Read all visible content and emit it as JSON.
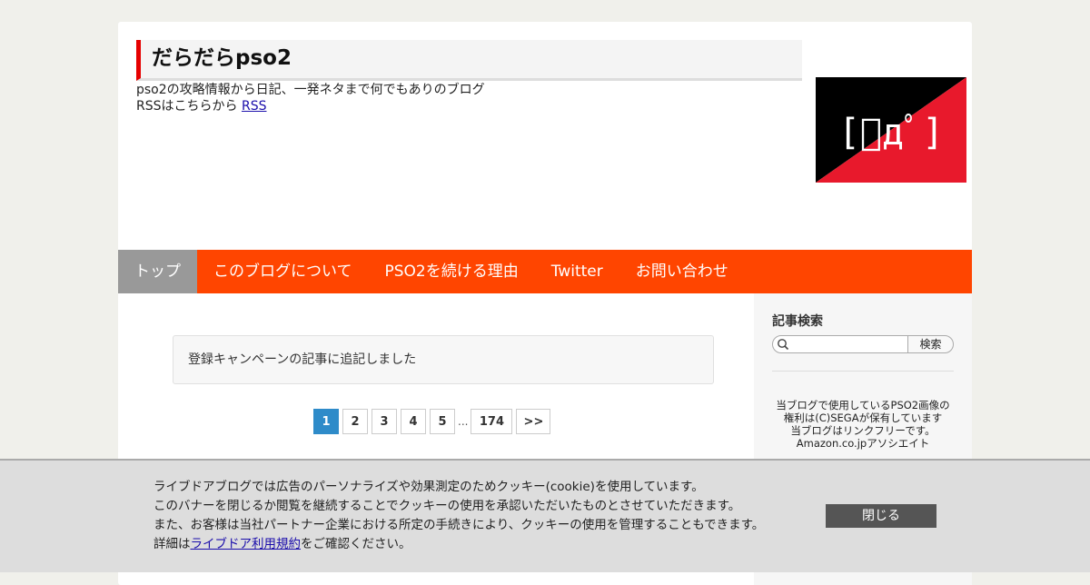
{
  "header": {
    "blog_title": "だらだらpso2",
    "tagline": "pso2の攻略情報から日記、一発ネタまで何でもありのブログ",
    "rss_prefix": "RSSはこちらから",
    "rss_link": "RSS",
    "logo_text": "[ﾟдﾟ]",
    "logo_colors": {
      "black": "#000000",
      "red": "#e8192c",
      "glyph": "#ffffff"
    }
  },
  "nav": {
    "items": [
      {
        "label": "トップ",
        "active": true
      },
      {
        "label": "このブログについて",
        "active": false
      },
      {
        "label": "PSO2を続ける理由",
        "active": false
      },
      {
        "label": "Twitter",
        "active": false
      },
      {
        "label": "お問い合わせ",
        "active": false
      }
    ],
    "bg_color": "#ff4500",
    "active_color": "#999999"
  },
  "main": {
    "notice": "登録キャンペーンの記事に追記しました",
    "pagination": {
      "pages": [
        "1",
        "2",
        "3",
        "4",
        "5"
      ],
      "ellipsis": "...",
      "last_page": "174",
      "next": ">>",
      "current": "1"
    }
  },
  "sidebar": {
    "search_heading": "記事検索",
    "search_placeholder": "",
    "search_button": "検索",
    "info_lines": [
      "当ブログで使用しているPSO2画像の",
      "権利は(C)SEGAが保有しています",
      "当ブログはリンクフリーです。",
      "Amazon.co.jpアソシエイト"
    ]
  },
  "cookie_banner": {
    "line1": "ライブドアブログでは広告のパーソナライズや効果測定のためクッキー(cookie)を使用しています。",
    "line2": "このバナーを閉じるか閲覧を継続することでクッキーの使用を承認いただいたものとさせていただきます。",
    "line3": "また、お客様は当社パートナー企業における所定の手続きにより、クッキーの使用を管理することもできます。",
    "line4_prefix": "詳細は",
    "line4_link": "ライブドア利用規約",
    "line4_suffix": "をご確認ください。",
    "close_button": "閉じる"
  },
  "colors": {
    "accent_red": "#e60000",
    "pager_current": "#2e8bc9",
    "close_button_bg": "#555555"
  }
}
